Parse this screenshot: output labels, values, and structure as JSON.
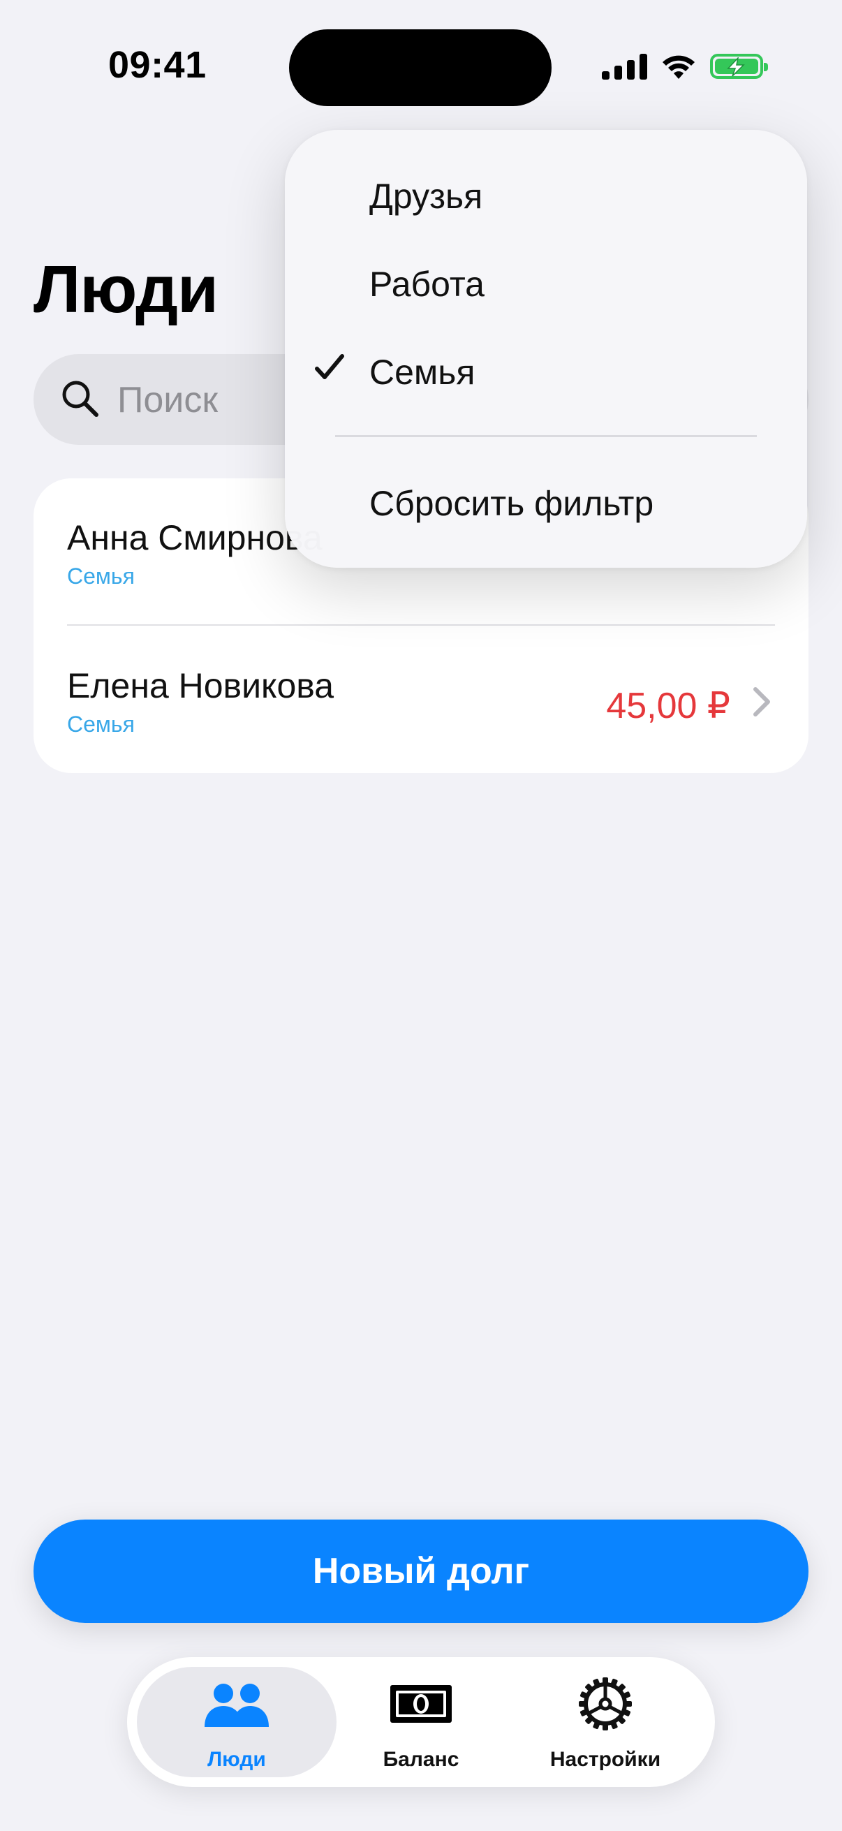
{
  "status_bar": {
    "time": "09:41"
  },
  "page": {
    "title": "Люди"
  },
  "search": {
    "placeholder": "Поиск"
  },
  "people": [
    {
      "name": "Анна Смирнова",
      "group": "Семья",
      "amount": "",
      "amount_color": "#34C759"
    },
    {
      "name": "Елена Новикова",
      "group": "Семья",
      "amount": "45,00 ₽",
      "amount_color": "#E5383B"
    }
  ],
  "filter_menu": {
    "options": [
      {
        "label": "Друзья",
        "checked": false
      },
      {
        "label": "Работа",
        "checked": false
      },
      {
        "label": "Семья",
        "checked": true
      }
    ],
    "reset_label": "Сбросить фильтр"
  },
  "primary_action": {
    "label": "Новый долг"
  },
  "tab_bar": {
    "tabs": [
      {
        "label": "Люди",
        "icon": "people-icon",
        "active": true
      },
      {
        "label": "Баланс",
        "icon": "banknote-icon",
        "active": false
      },
      {
        "label": "Настройки",
        "icon": "gear-icon",
        "active": false
      }
    ]
  },
  "colors": {
    "accent": "#0A84FF",
    "group_text": "#38A7E8",
    "negative": "#E5383B",
    "positive": "#34C759",
    "background": "#F2F2F7"
  }
}
